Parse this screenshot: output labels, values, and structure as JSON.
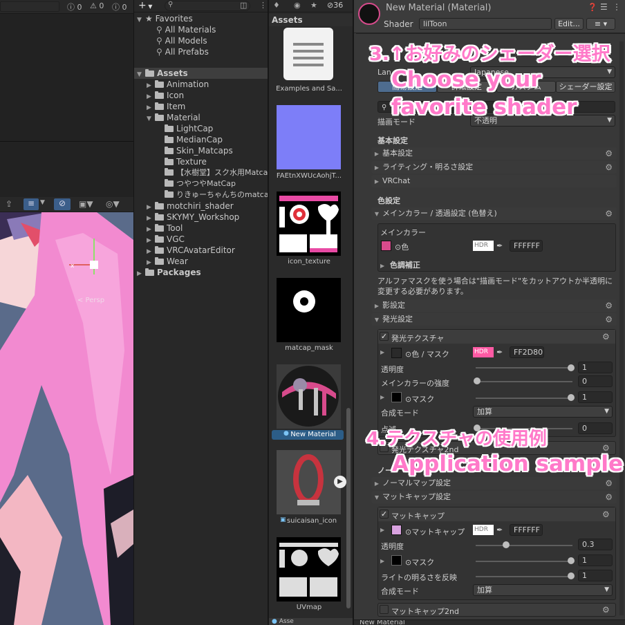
{
  "console_bar": {
    "warn_count": "0",
    "info_count": "0",
    "error_count": "0"
  },
  "project": {
    "toolbar": {
      "add_label": "+",
      "search_placeholder": "",
      "badge_count": "36"
    },
    "favorites": {
      "label": "Favorites",
      "items": [
        {
          "label": "All Materials"
        },
        {
          "label": "All Models"
        },
        {
          "label": "All Prefabs"
        }
      ]
    },
    "assets_label": "Assets",
    "folders": [
      {
        "label": "Animation"
      },
      {
        "label": "Icon"
      },
      {
        "label": "Item"
      },
      {
        "label": "Material"
      },
      {
        "label": "LightCap"
      },
      {
        "label": "MedianCap"
      },
      {
        "label": "Skin_Matcaps"
      },
      {
        "label": "Texture"
      },
      {
        "label": "【水樹堂】スク水用Matcap"
      },
      {
        "label": "つやつやMatCap"
      },
      {
        "label": "りきゅーちゃんちのmatcap v"
      },
      {
        "label": "motchiri_shader"
      },
      {
        "label": "SKYMY_Workshop"
      },
      {
        "label": "Tool"
      },
      {
        "label": "VGC"
      },
      {
        "label": "VRCAvatarEditor"
      },
      {
        "label": "Wear"
      }
    ],
    "packages_label": "Packages"
  },
  "assets_panel": {
    "header": "Assets",
    "items": [
      {
        "label": "Examples and Sa..."
      },
      {
        "label": "FAEtnXWUcAohjT..."
      },
      {
        "label": "icon_texture"
      },
      {
        "label": "matcap_mask"
      },
      {
        "label": "New Material"
      },
      {
        "label": "suicaisan_icon"
      },
      {
        "label": "UVmap"
      }
    ],
    "footer": "Asse"
  },
  "scene": {
    "persp_label": "< Persp"
  },
  "inspector": {
    "title": "New Material (Material)",
    "shader_label": "Shader",
    "shader_value": "lilToon",
    "edit_button": "Edit...",
    "lang_label": "Lan",
    "lang_value": "Japanese",
    "tabs": [
      "簡易設定",
      "詳細設定",
      "カスタム",
      "シェーダー設定"
    ],
    "draw_mode_label": "描画モード",
    "draw_mode_value": "不透明",
    "basic_header": "基本設定",
    "sections_top": [
      "基本設定",
      "ライティング・明るさ設定",
      "VRChat"
    ],
    "color_header": "色設定",
    "main_color_section": "メインカラー / 透過設定 (色替え)",
    "main_color_box_title": "メインカラー",
    "color_label": "色",
    "color_hex": "FFFFFF",
    "hdr_label": "HDR",
    "color_correction": "色調補正",
    "alpha_note": "アルファマスクを使う場合は\"描画モード\"をカットアウトか半透明に変更する必要があります。",
    "shadow_section": "影設定",
    "emission_section": "発光設定",
    "emission_texture": "発光テクスチャ",
    "emission_color_label": "色 / マスク",
    "emission_hex": "FF2D80",
    "emission_color": "#ff2d80",
    "transparency_label": "透明度",
    "transparency_value": "1",
    "main_strength_label": "メインカラーの強度",
    "main_strength_value": "0",
    "mask_label": "マスク",
    "mask_value": "1",
    "blend_label": "合成モード",
    "blend_value": "加算",
    "blink_label": "点滅",
    "blink_value": "0",
    "emission2_label": "発光テクスチャ2nd",
    "normal_header": "ノー",
    "normal_section": "ノーマルマップ設定",
    "matcap_section": "マットキャップ設定",
    "matcap_box": "マットキャップ",
    "matcap_tex_label": "マットキャップ",
    "matcap_hex": "FFFFFF",
    "matcap_trans_label": "透明度",
    "matcap_trans_value": "0.3",
    "matcap_mask_label": "マスク",
    "matcap_mask_value": "1",
    "light_reflect_label": "ライトの明るさを反映",
    "light_reflect_value": "1",
    "matcap_blend_label": "合成モード",
    "matcap_blend_value": "加算",
    "matcap2_label": "マットキャップ2nd",
    "footer": "New Material"
  },
  "annotations": {
    "step3_jp": "3.↑お好みのシェーダー選択",
    "step3_en1": "Choose your",
    "step3_en2": "favorite shader",
    "step4_jp": "4.テクスチャの使用例",
    "step4_en": "Application sample"
  },
  "colors": {
    "overlay_pink": "#ff79c9",
    "hair_pink": "#f28ad0",
    "panel_bg": "#383838"
  }
}
